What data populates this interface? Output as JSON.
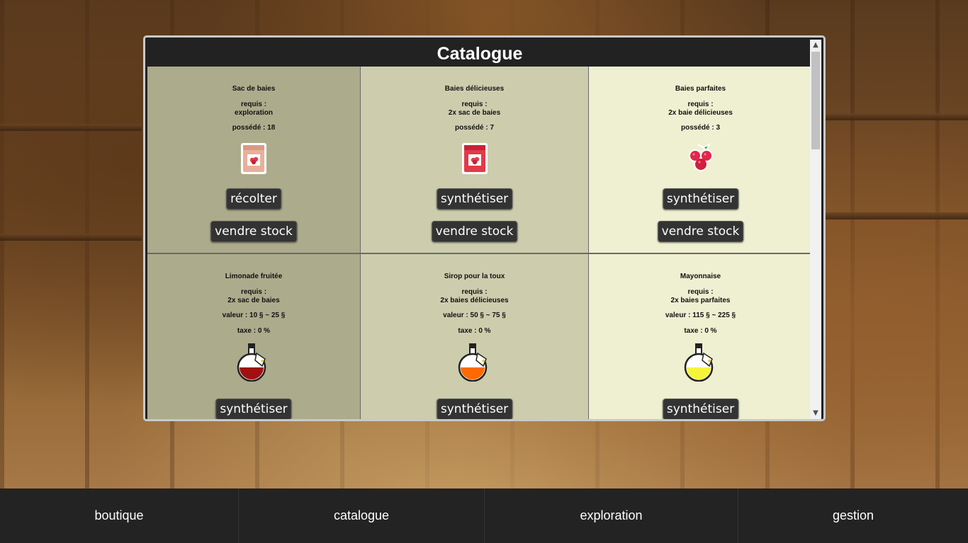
{
  "catalogue": {
    "title": "Catalogue",
    "items": [
      {
        "name": "Sac de baies",
        "requires_label": "requis :",
        "requires": "exploration",
        "owned": "possédé : 18",
        "icon": "berry-bag-icon",
        "color": "#e8b09a",
        "action_label": "récolter",
        "sell_label": "vendre stock"
      },
      {
        "name": "Baies délicieuses",
        "requires_label": "requis :",
        "requires": "2x sac de baies",
        "owned": "possédé : 7",
        "icon": "berry-bag-icon",
        "color": "#e23a48",
        "action_label": "synthétiser",
        "sell_label": "vendre stock"
      },
      {
        "name": "Baies parfaites",
        "requires_label": "requis :",
        "requires": "2x baie délicieuses",
        "owned": "possédé : 3",
        "icon": "raspberries-icon",
        "color": "#e0284a",
        "action_label": "synthétiser",
        "sell_label": "vendre stock"
      },
      {
        "name": "Limonade fruitée",
        "requires_label": "requis :",
        "requires": "2x sac de baies",
        "value": "valeur : 10 § ~ 25 §",
        "tax": "taxe : 0 %",
        "icon": "potion-bottle-icon",
        "color": "#a01010",
        "action_label": "synthétiser"
      },
      {
        "name": "Sirop pour la toux",
        "requires_label": "requis :",
        "requires": "2x baies délicieuses",
        "value": "valeur : 50 § ~ 75 §",
        "tax": "taxe : 0 %",
        "icon": "potion-bottle-icon",
        "color": "#ff6a00",
        "action_label": "synthétiser"
      },
      {
        "name": "Mayonnaise",
        "requires_label": "requis :",
        "requires": "2x baies parfaites",
        "value": "valeur : 115 § ~ 225 §",
        "tax": "taxe : 0 %",
        "icon": "potion-bottle-icon",
        "color": "#f6f43a",
        "action_label": "synthétiser"
      }
    ]
  },
  "nav": {
    "items": [
      "boutique",
      "catalogue",
      "exploration",
      "gestion"
    ]
  }
}
